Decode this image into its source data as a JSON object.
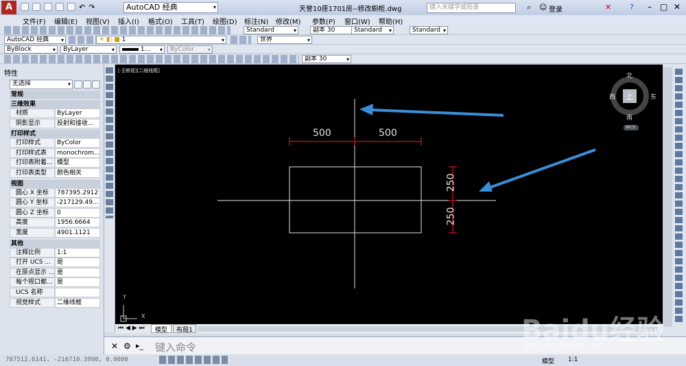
{
  "titlebar": {
    "workspace": "AutoCAD 经典",
    "document": "天誉10座1701房--修改橱柜.dwg",
    "search_placeholder": "键入关键字或短语",
    "login": "登录"
  },
  "menu": [
    "文件(F)",
    "编辑(E)",
    "视图(V)",
    "插入(I)",
    "格式(O)",
    "工具(T)",
    "绘图(D)",
    "标注(N)",
    "修改(M)",
    "参数(P)",
    "窗口(W)",
    "帮助(H)"
  ],
  "toolbar2": {
    "text_style": "Standard",
    "dim_style": "副本 30",
    "table_style": "Standard",
    "mleader_style": "Standard"
  },
  "toolbar3": {
    "workspace": "AutoCAD 经典",
    "layer": "1",
    "ucs": "世界"
  },
  "toolbar4": {
    "color": "ByBlock",
    "linetype": "ByLayer",
    "lineweight": "1...",
    "plotstyle": "ByColor"
  },
  "toolbar5": {
    "dim_style": "副本 30"
  },
  "properties": {
    "title": "特性",
    "selection": "无选择",
    "sections": [
      {
        "name": "常规",
        "rows": []
      },
      {
        "name": "三维效果",
        "rows": [
          [
            "材质",
            "ByLayer"
          ],
          [
            "阴影显示",
            "投射和接收..."
          ]
        ]
      },
      {
        "name": "打印样式",
        "rows": [
          [
            "打印样式",
            "ByColor"
          ],
          [
            "打印样式表",
            "monochrom..."
          ],
          [
            "打印表附着...",
            "模型"
          ],
          [
            "打印表类型",
            "颜色相关"
          ]
        ]
      },
      {
        "name": "视图",
        "rows": [
          [
            "圆心 X 坐标",
            "787395.2912"
          ],
          [
            "圆心 Y 坐标",
            "-217129.49..."
          ],
          [
            "圆心 Z 坐标",
            "0"
          ],
          [
            "高度",
            "1956.6664"
          ],
          [
            "宽度",
            "4901.1121"
          ]
        ]
      },
      {
        "name": "其他",
        "rows": [
          [
            "注释比例",
            "1:1"
          ],
          [
            "打开 UCS ...",
            "是"
          ],
          [
            "在原点显示 ...",
            "是"
          ],
          [
            "每个视口都...",
            "是"
          ],
          [
            "UCS 名称",
            ""
          ],
          [
            "视觉样式",
            "二维线框"
          ]
        ]
      }
    ]
  },
  "canvas": {
    "viewport_label": "[-][俯视][二维线框]",
    "viewcube": {
      "north": "北",
      "south": "南",
      "east": "东",
      "west": "西",
      "face": "上",
      "wcs": "WCS"
    },
    "dims": {
      "top_left": "500",
      "top_right": "500",
      "right_top": "250",
      "right_bottom": "250"
    },
    "ucs_y": "Y",
    "ucs_x": "X",
    "dim_color": "#ff1a1a",
    "arrow_color": "#3a8fd9"
  },
  "tabs": [
    "模型",
    "布局1"
  ],
  "command": {
    "placeholder": "键入命令"
  },
  "status": {
    "coords": "787512.6141, -216710.3998, 0.0000",
    "model": "模型",
    "scale": "1:1"
  },
  "watermark": {
    "brand": "Baidu经验",
    "url": "jingyan.baidu.com"
  }
}
